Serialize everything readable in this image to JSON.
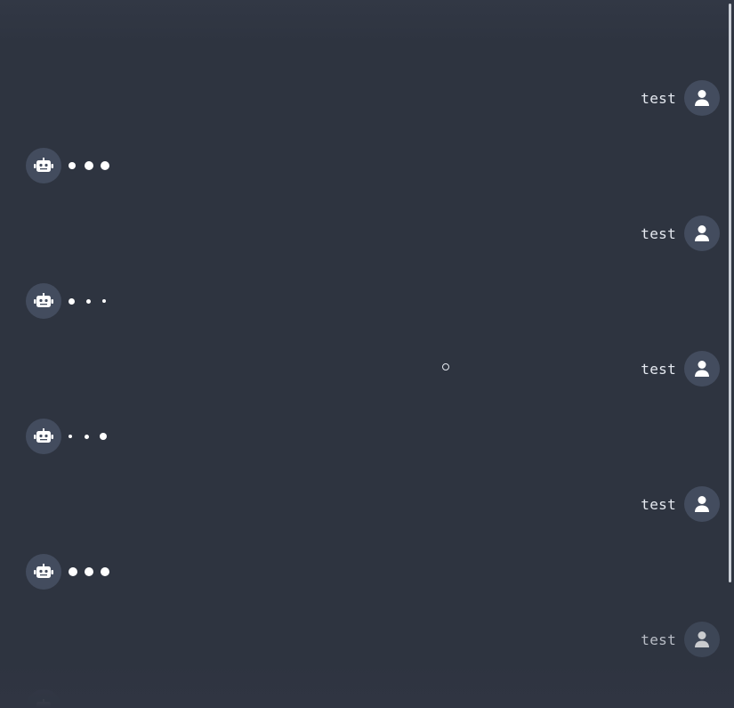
{
  "messages": [
    {
      "role": "user",
      "text": "test"
    },
    {
      "role": "bot",
      "typing": true
    },
    {
      "role": "user",
      "text": "test"
    },
    {
      "role": "bot",
      "typing": true
    },
    {
      "role": "user",
      "text": "test"
    },
    {
      "role": "bot",
      "typing": true
    },
    {
      "role": "user",
      "text": "test"
    },
    {
      "role": "bot",
      "typing": true
    },
    {
      "role": "user",
      "text": "test"
    }
  ],
  "icons": {
    "user_avatar": "user-icon",
    "bot_avatar": "robot-icon"
  },
  "colors": {
    "background": "#2e3440",
    "avatar_bg": "#434c5e",
    "text": "#e5e9f0"
  }
}
